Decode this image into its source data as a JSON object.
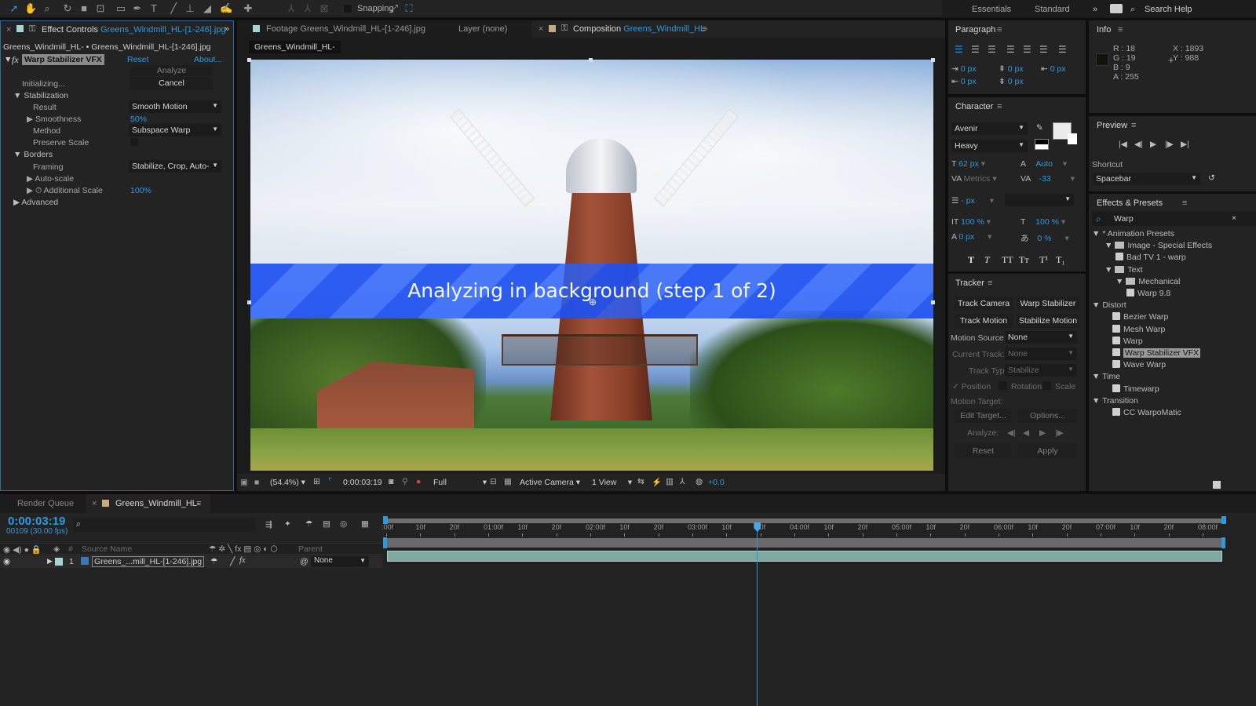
{
  "toolbar": {
    "tools": [
      "selection-tool",
      "hand-tool",
      "zoom-tool",
      "rotation-tool",
      "camera-tool",
      "pan-behind-tool",
      "rectangle-tool",
      "pen-tool",
      "type-tool",
      "brush-tool",
      "clone-stamp-tool",
      "eraser-tool",
      "roto-brush-tool",
      "puppet-pin-tool"
    ],
    "axis_tools": [
      "local-axis",
      "world-axis",
      "view-axis"
    ],
    "snapping_label": "Snapping",
    "workspaces": [
      "Essentials",
      "Standard"
    ],
    "more": "»",
    "search_help": "Search Help"
  },
  "effect_controls": {
    "tab_title": "Effect Controls",
    "tab_file": "Greens_Windmill_HL-[1-246].jpg",
    "breadcrumb": "Greens_Windmill_HL- • Greens_Windmill_HL-[1-246].jpg",
    "effect_name": "Warp Stabilizer VFX",
    "reset": "Reset",
    "about": "About...",
    "analyze": "Analyze",
    "cancel": "Cancel",
    "status": "Initializing...",
    "stabilization": "Stabilization",
    "result_label": "Result",
    "result_value": "Smooth Motion",
    "smoothness_label": "Smoothness",
    "smoothness_value": "50%",
    "method_label": "Method",
    "method_value": "Subspace Warp",
    "preserve_scale_label": "Preserve Scale",
    "borders": "Borders",
    "framing_label": "Framing",
    "framing_value": "Stabilize, Crop, Auto-",
    "autoscale_label": "Auto-scale",
    "additional_scale_label": "Additional Scale",
    "additional_scale_value": "100%",
    "advanced": "Advanced"
  },
  "viewer": {
    "tabs": [
      "Footage Greens_Windmill_HL-[1-246].jpg",
      "Layer (none)"
    ],
    "comp_tab_prefix": "Composition",
    "comp_tab_name": "Greens_Windmill_HL-",
    "comp_crumb": "Greens_Windmill_HL-",
    "banner": "Analyzing in background (step 1 of 2)",
    "footer": {
      "zoom": "(54.4%)",
      "timecode": "0:00:03:19",
      "resolution": "Full",
      "camera": "Active Camera",
      "views": "1 View",
      "exposure": "+0.0"
    }
  },
  "paragraph": {
    "title": "Paragraph",
    "indent_values": [
      "0 px",
      "0 px",
      "0 px",
      "0 px",
      "0 px"
    ]
  },
  "character": {
    "title": "Character",
    "font": "Avenir",
    "style": "Heavy",
    "size": "62 px",
    "leading": "Auto",
    "kerning": "Metrics",
    "tracking": "-33",
    "stroke": "- px",
    "vscale": "100 %",
    "hscale": "100 %",
    "baseline": "0 px",
    "tsume": "0 %",
    "styles": [
      "T",
      "T",
      "TT",
      "Tт",
      "T¹",
      "T₁"
    ]
  },
  "tracker": {
    "title": "Tracker",
    "track_camera": "Track Camera",
    "warp_stabilizer": "Warp Stabilizer",
    "track_motion": "Track Motion",
    "stabilize_motion": "Stabilize Motion",
    "motion_source_label": "Motion Source:",
    "motion_source_value": "None",
    "current_track_label": "Current Track:",
    "current_track_value": "None",
    "track_type_label": "Track Type:",
    "track_type_value": "Stabilize",
    "position": "Position",
    "rotation": "Rotation",
    "scale": "Scale",
    "motion_target": "Motion Target:",
    "edit_target": "Edit Target...",
    "options": "Options...",
    "analyze": "Analyze:",
    "reset": "Reset",
    "apply": "Apply"
  },
  "info": {
    "title": "Info",
    "r": "R : 18",
    "g": "G : 19",
    "b": "B : 9",
    "a": "A : 255",
    "x": "X : 1893",
    "y": "Y : 988",
    "swatch": "#12130b"
  },
  "preview": {
    "title": "Preview",
    "shortcut_label": "Shortcut",
    "shortcut_value": "Spacebar"
  },
  "effects_presets": {
    "title": "Effects & Presets",
    "search": "Warp",
    "tree": [
      {
        "label": "* Animation Presets",
        "level": 0,
        "type": "group"
      },
      {
        "label": "Image - Special Effects",
        "level": 1,
        "type": "folder"
      },
      {
        "label": "Bad TV 1 - warp",
        "level": 2,
        "type": "preset"
      },
      {
        "label": "Text",
        "level": 1,
        "type": "folder"
      },
      {
        "label": "Mechanical",
        "level": 2,
        "type": "folder"
      },
      {
        "label": "Warp 9.8",
        "level": 3,
        "type": "preset"
      },
      {
        "label": "Distort",
        "level": 0,
        "type": "group"
      },
      {
        "label": "Bezier Warp",
        "level": 1,
        "type": "effect"
      },
      {
        "label": "Mesh Warp",
        "level": 1,
        "type": "effect"
      },
      {
        "label": "Warp",
        "level": 1,
        "type": "effect"
      },
      {
        "label": "Warp Stabilizer VFX",
        "level": 1,
        "type": "effect",
        "selected": true
      },
      {
        "label": "Wave Warp",
        "level": 1,
        "type": "effect"
      },
      {
        "label": "Time",
        "level": 0,
        "type": "group"
      },
      {
        "label": "Timewarp",
        "level": 1,
        "type": "effect"
      },
      {
        "label": "Transition",
        "level": 0,
        "type": "group"
      },
      {
        "label": "CC WarpoMatic",
        "level": 1,
        "type": "effect"
      }
    ]
  },
  "timeline": {
    "render_queue": "Render Queue",
    "comp_tab": "Greens_Windmill_HL-",
    "timecode": "0:00:03:19",
    "frame_info": "00109 (30.00 fps)",
    "col_hash": "#",
    "col_source": "Source Name",
    "col_parent": "Parent",
    "layer_num": "1",
    "layer_name": "Greens_...mill_HL-[1-246].jpg",
    "parent_value": "None",
    "ruler": [
      ":00f",
      "10f",
      "20f",
      "01:00f",
      "10f",
      "20f",
      "02:00f",
      "10f",
      "20f",
      "03:00f",
      "10f",
      "20f",
      "04:00f",
      "10f",
      "20f",
      "05:00f",
      "10f",
      "20f",
      "06:00f",
      "10f",
      "20f",
      "07:00f",
      "10f",
      "20f",
      "08:00f"
    ],
    "playhead_frame": 109,
    "total_frames": 246
  }
}
